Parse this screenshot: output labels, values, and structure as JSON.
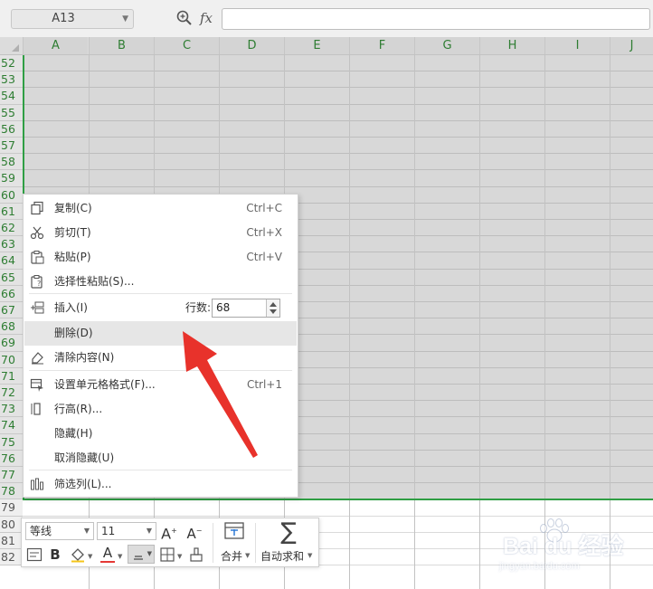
{
  "name_box": {
    "value": "A13"
  },
  "formula": {
    "fx_label": "fx",
    "value": ""
  },
  "columns": [
    "A",
    "B",
    "C",
    "D",
    "E",
    "F",
    "G",
    "H",
    "I",
    "J"
  ],
  "rows": [
    "52",
    "53",
    "54",
    "55",
    "56",
    "57",
    "58",
    "59",
    "60",
    "61",
    "62",
    "63",
    "64",
    "65",
    "66",
    "67",
    "68",
    "69",
    "70",
    "71",
    "72",
    "73",
    "74",
    "75",
    "76",
    "77",
    "78",
    "79",
    "80",
    "81",
    "82"
  ],
  "context_menu": {
    "items": [
      {
        "label": "复制(C)",
        "shortcut": "Ctrl+C",
        "icon": "copy-icon"
      },
      {
        "label": "剪切(T)",
        "shortcut": "Ctrl+X",
        "icon": "scissors-icon"
      },
      {
        "label": "粘贴(P)",
        "shortcut": "Ctrl+V",
        "icon": "paste-icon"
      },
      {
        "label": "选择性粘贴(S)...",
        "shortcut": "",
        "icon": "paste-special-icon"
      },
      {
        "label": "插入(I)",
        "shortcut": "",
        "icon": "insert-row-icon"
      },
      {
        "label": "删除(D)",
        "shortcut": "",
        "icon": ""
      },
      {
        "label": "清除内容(N)",
        "shortcut": "",
        "icon": "eraser-icon"
      },
      {
        "label": "设置单元格格式(F)...",
        "shortcut": "Ctrl+1",
        "icon": "format-cells-icon"
      },
      {
        "label": "行高(R)...",
        "shortcut": "",
        "icon": "row-height-icon"
      },
      {
        "label": "隐藏(H)",
        "shortcut": "",
        "icon": ""
      },
      {
        "label": "取消隐藏(U)",
        "shortcut": "",
        "icon": ""
      },
      {
        "label": "筛选列(L)...",
        "shortcut": "",
        "icon": "filter-columns-icon"
      }
    ],
    "rows_label": "行数:",
    "rows_value": "68",
    "highlighted": "删除(D)"
  },
  "mini_toolbar": {
    "font_name": "等线",
    "font_size": "11",
    "increase_font": "A",
    "decrease_font": "A",
    "bold": "B",
    "font_color_letter": "A",
    "font_color": "#e53935",
    "merge_label": "合并",
    "autosum_label": "自动求和"
  },
  "watermark": {
    "main": "Bai du 经验",
    "sub": "jingyan.baidu.com"
  },
  "colors": {
    "accent": "#2f9e44",
    "arrow": "#e8322b",
    "header_text": "#2e7d32"
  }
}
